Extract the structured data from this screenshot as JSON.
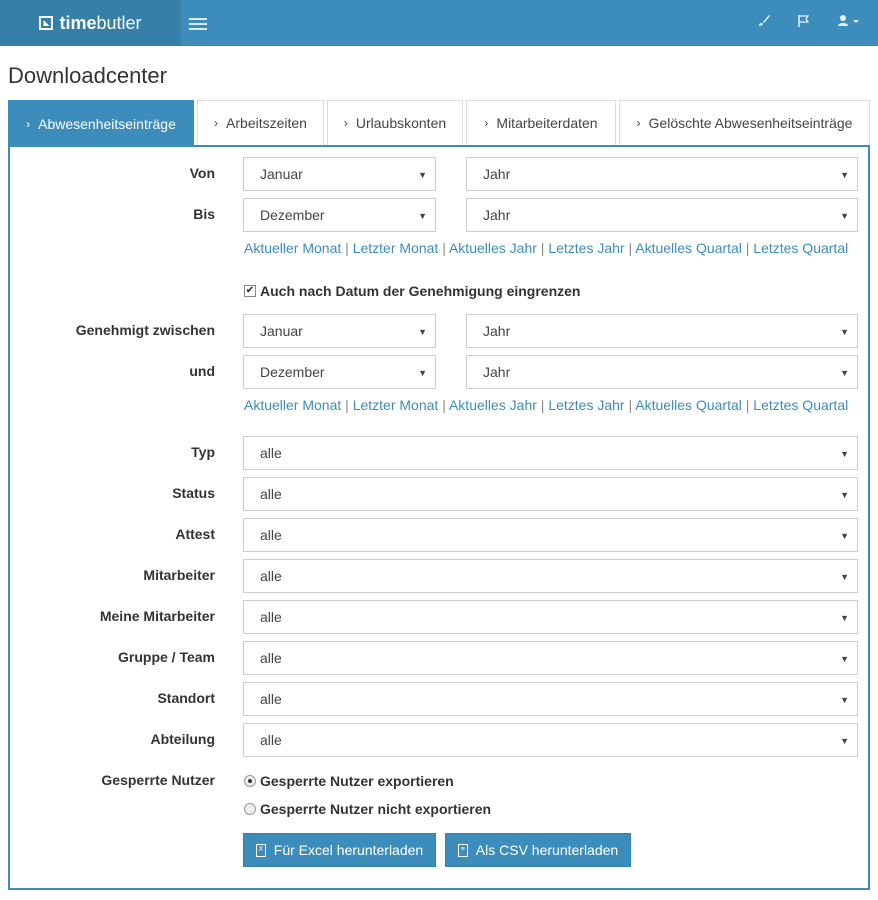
{
  "brand": {
    "bold": "time",
    "regular": "butler"
  },
  "nav_icons": [
    "brush-icon",
    "flag-icon",
    "user-icon"
  ],
  "page_title": "Downloadcenter",
  "tabs": [
    {
      "label": "Abwesenheitseinträge",
      "active": true
    },
    {
      "label": "Arbeitszeiten",
      "active": false
    },
    {
      "label": "Urlaubskonten",
      "active": false
    },
    {
      "label": "Mitarbeiterdaten",
      "active": false
    },
    {
      "label": "Gelöschte Abwesenheitseinträge",
      "active": false
    }
  ],
  "form": {
    "von": {
      "label": "Von",
      "month": "Januar",
      "year": "Jahr"
    },
    "bis": {
      "label": "Bis",
      "month": "Dezember",
      "year": "Jahr"
    },
    "quick_links": [
      "Aktueller Monat",
      "Letzter Monat",
      "Aktuelles Jahr",
      "Letztes Jahr",
      "Aktuelles Quartal",
      "Letztes Quartal"
    ],
    "approval_checkbox": {
      "label": "Auch nach Datum der Genehmigung eingrenzen",
      "checked": true
    },
    "approved_from": {
      "label": "Genehmigt zwischen",
      "month": "Januar",
      "year": "Jahr"
    },
    "approved_to": {
      "label": "und",
      "month": "Dezember",
      "year": "Jahr"
    },
    "filters": [
      {
        "label": "Typ",
        "value": "alle"
      },
      {
        "label": "Status",
        "value": "alle"
      },
      {
        "label": "Attest",
        "value": "alle"
      },
      {
        "label": "Mitarbeiter",
        "value": "alle"
      },
      {
        "label": "Meine Mitarbeiter",
        "value": "alle"
      },
      {
        "label": "Gruppe / Team",
        "value": "alle"
      },
      {
        "label": "Standort",
        "value": "alle"
      },
      {
        "label": "Abteilung",
        "value": "alle"
      }
    ],
    "blocked_users": {
      "label": "Gesperrte Nutzer",
      "options": [
        {
          "label": "Gesperrte Nutzer exportieren",
          "checked": true
        },
        {
          "label": "Gesperrte Nutzer nicht exportieren",
          "checked": false
        }
      ]
    },
    "buttons": {
      "excel": "Für Excel herunterladen",
      "csv": "Als CSV herunterladen"
    },
    "separator": "|"
  },
  "colors": {
    "primary": "#3c8dbc",
    "primary_dark": "#367fa9",
    "link": "#3c8dbc"
  }
}
